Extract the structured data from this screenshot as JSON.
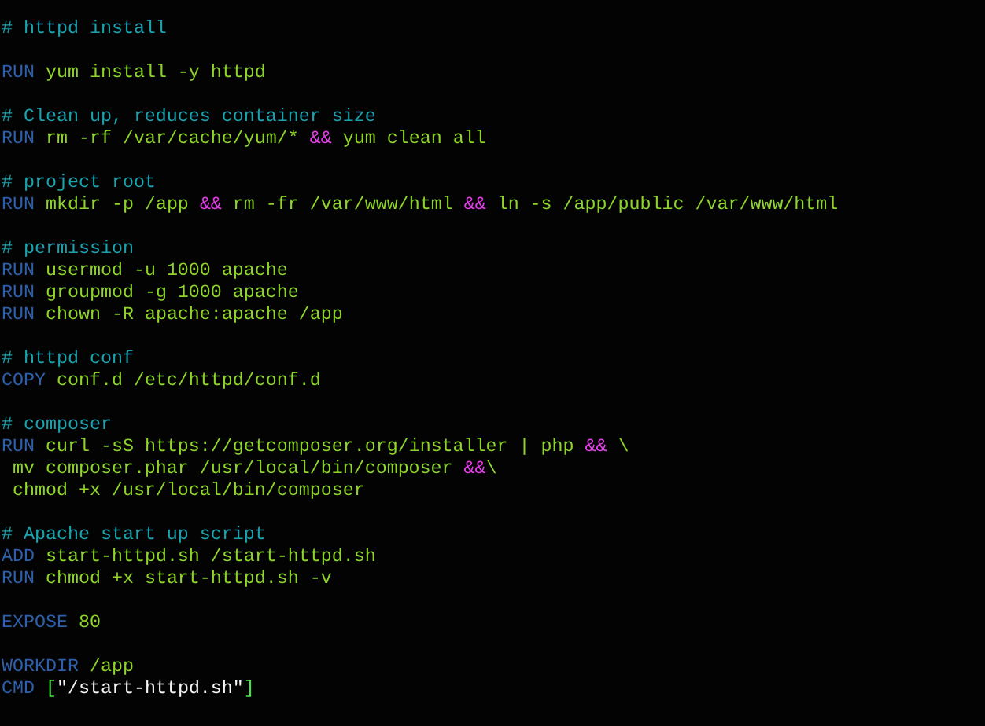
{
  "editor": {
    "lines": [
      {
        "kind": "code",
        "tokens": [
          {
            "kind": "comment",
            "text": "# httpd install"
          }
        ]
      },
      {
        "kind": "blank"
      },
      {
        "kind": "code",
        "tokens": [
          {
            "kind": "keyword",
            "text": "RUN"
          },
          {
            "kind": "text",
            "text": " yum install -y httpd"
          }
        ]
      },
      {
        "kind": "blank"
      },
      {
        "kind": "code",
        "tokens": [
          {
            "kind": "comment",
            "text": "# Clean up, reduces container size"
          }
        ]
      },
      {
        "kind": "code",
        "tokens": [
          {
            "kind": "keyword",
            "text": "RUN"
          },
          {
            "kind": "text",
            "text": " rm -rf /var/cache/yum/* "
          },
          {
            "kind": "operator",
            "text": "&&"
          },
          {
            "kind": "text",
            "text": " yum clean all"
          }
        ]
      },
      {
        "kind": "blank"
      },
      {
        "kind": "code",
        "tokens": [
          {
            "kind": "comment",
            "text": "# project root"
          }
        ]
      },
      {
        "kind": "code",
        "tokens": [
          {
            "kind": "keyword",
            "text": "RUN"
          },
          {
            "kind": "text",
            "text": " mkdir -p /app "
          },
          {
            "kind": "operator",
            "text": "&&"
          },
          {
            "kind": "text",
            "text": " rm -fr /var/www/html "
          },
          {
            "kind": "operator",
            "text": "&&"
          },
          {
            "kind": "text",
            "text": " ln -s /app/public /var/www/html"
          }
        ]
      },
      {
        "kind": "blank"
      },
      {
        "kind": "code",
        "tokens": [
          {
            "kind": "comment",
            "text": "# permission"
          }
        ]
      },
      {
        "kind": "code",
        "tokens": [
          {
            "kind": "keyword",
            "text": "RUN"
          },
          {
            "kind": "text",
            "text": " usermod -u 1000 apache"
          }
        ]
      },
      {
        "kind": "code",
        "tokens": [
          {
            "kind": "keyword",
            "text": "RUN"
          },
          {
            "kind": "text",
            "text": " groupmod -g 1000 apache"
          }
        ]
      },
      {
        "kind": "code",
        "tokens": [
          {
            "kind": "keyword",
            "text": "RUN"
          },
          {
            "kind": "text",
            "text": " chown -R apache:apache /app"
          }
        ]
      },
      {
        "kind": "blank"
      },
      {
        "kind": "code",
        "tokens": [
          {
            "kind": "comment",
            "text": "# httpd conf"
          }
        ]
      },
      {
        "kind": "code",
        "tokens": [
          {
            "kind": "keyword",
            "text": "COPY"
          },
          {
            "kind": "text",
            "text": " conf.d /etc/httpd/conf.d"
          }
        ]
      },
      {
        "kind": "blank"
      },
      {
        "kind": "code",
        "tokens": [
          {
            "kind": "comment",
            "text": "# composer"
          }
        ]
      },
      {
        "kind": "code",
        "tokens": [
          {
            "kind": "keyword",
            "text": "RUN"
          },
          {
            "kind": "text",
            "text": " curl -sS https://getcomposer.org/installer | php "
          },
          {
            "kind": "operator",
            "text": "&&"
          },
          {
            "kind": "text",
            "text": " \\"
          }
        ]
      },
      {
        "kind": "code",
        "tokens": [
          {
            "kind": "text",
            "text": " mv composer.phar /usr/local/bin/composer "
          },
          {
            "kind": "operator",
            "text": "&&"
          },
          {
            "kind": "text",
            "text": "\\"
          }
        ]
      },
      {
        "kind": "code",
        "tokens": [
          {
            "kind": "text",
            "text": " chmod +x /usr/local/bin/composer"
          }
        ]
      },
      {
        "kind": "blank"
      },
      {
        "kind": "code",
        "tokens": [
          {
            "kind": "comment",
            "text": "# Apache start up script"
          }
        ]
      },
      {
        "kind": "code",
        "tokens": [
          {
            "kind": "keyword",
            "text": "ADD"
          },
          {
            "kind": "text",
            "text": " start-httpd.sh /start-httpd.sh"
          }
        ]
      },
      {
        "kind": "code",
        "tokens": [
          {
            "kind": "keyword",
            "text": "RUN"
          },
          {
            "kind": "text",
            "text": " chmod +x start-httpd.sh -v"
          }
        ]
      },
      {
        "kind": "blank"
      },
      {
        "kind": "code",
        "tokens": [
          {
            "kind": "keyword",
            "text": "EXPOSE"
          },
          {
            "kind": "text",
            "text": " 80"
          }
        ]
      },
      {
        "kind": "blank"
      },
      {
        "kind": "code",
        "tokens": [
          {
            "kind": "keyword",
            "text": "WORKDIR"
          },
          {
            "kind": "text",
            "text": " /app"
          }
        ]
      },
      {
        "kind": "code",
        "tokens": [
          {
            "kind": "keyword",
            "text": "CMD"
          },
          {
            "kind": "bracket",
            "text": " ["
          },
          {
            "kind": "string",
            "text": "\"/start-httpd.sh\""
          },
          {
            "kind": "bracket",
            "text": "]"
          }
        ]
      }
    ]
  }
}
